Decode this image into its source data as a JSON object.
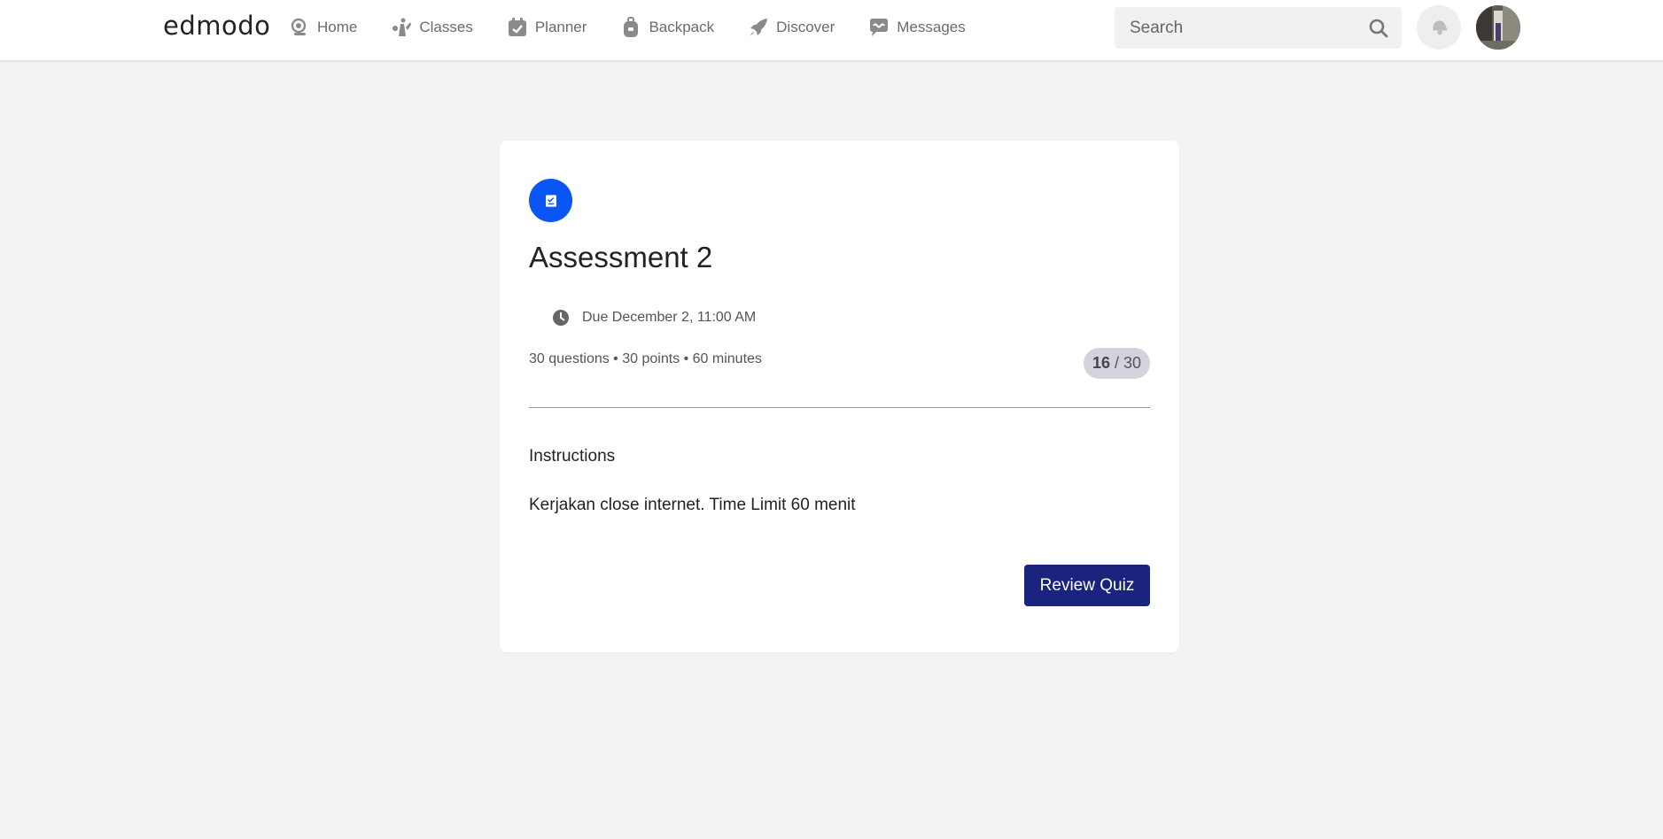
{
  "header": {
    "logo_text": "edmodo",
    "nav": [
      {
        "label": "Home",
        "icon": "home-icon"
      },
      {
        "label": "Classes",
        "icon": "classes-icon"
      },
      {
        "label": "Planner",
        "icon": "planner-icon"
      },
      {
        "label": "Backpack",
        "icon": "backpack-icon"
      },
      {
        "label": "Discover",
        "icon": "rocket-icon"
      },
      {
        "label": "Messages",
        "icon": "messages-icon"
      }
    ],
    "search_placeholder": "Search",
    "search_icon": "search-icon",
    "notifications_icon": "bell-icon",
    "avatar": "avatar"
  },
  "assignment": {
    "icon": "quiz-icon",
    "icon_color": "#0a56f5",
    "title": "Assessment 2",
    "due_icon": "clock-icon",
    "due": "Due December 2, 11:00 AM",
    "meta": "30 questions • 30 points • 60 minutes",
    "score_value": "16",
    "score_separator": "/",
    "score_total": "30",
    "instructions_heading": "Instructions",
    "instructions_text": "Kerjakan close internet. Time Limit 60 menit",
    "review_button": "Review Quiz",
    "review_button_color": "#1a237e"
  }
}
